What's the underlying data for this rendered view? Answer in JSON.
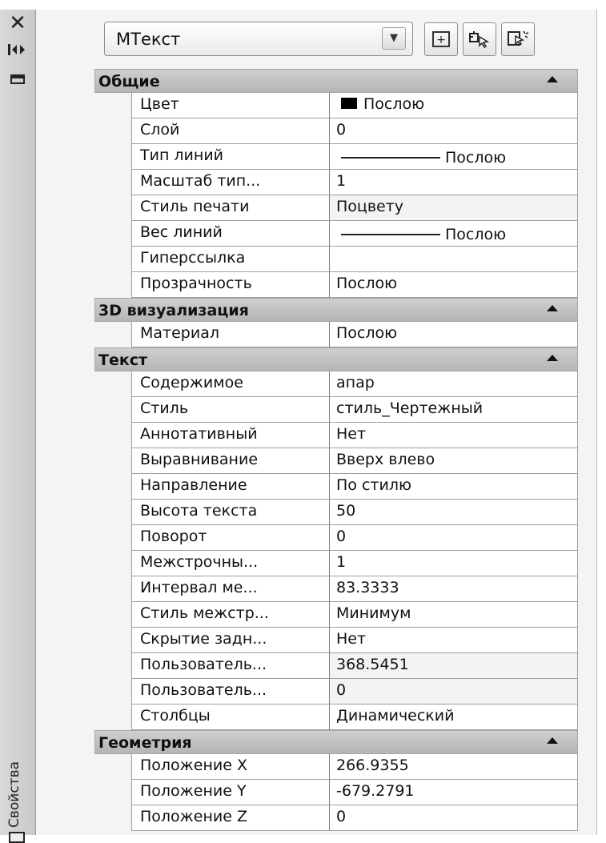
{
  "strip": {
    "close_icon": "✕",
    "autohide_icon": "⇹",
    "title": "Свойства"
  },
  "selector": {
    "value": "МТекст",
    "dropdown_icon": "chevron-down-icon"
  },
  "toolbar": {
    "buttons": [
      {
        "icon": "toggle-pickadd-icon"
      },
      {
        "icon": "select-objects-icon"
      },
      {
        "icon": "quick-select-icon"
      }
    ]
  },
  "sections": {
    "general": {
      "title": "Общие",
      "rows": [
        {
          "name": "Цвет",
          "value": "Послою"
        },
        {
          "name": "Слой",
          "value": "0"
        },
        {
          "name": "Тип линий",
          "value": "Послою"
        },
        {
          "name": "Масштаб тип...",
          "value": "1"
        },
        {
          "name": "Стиль печати",
          "value": "Поцвету"
        },
        {
          "name": "Вес линий",
          "value": "Послою"
        },
        {
          "name": "Гиперссылка",
          "value": ""
        },
        {
          "name": "Прозрачность",
          "value": "Послою"
        }
      ]
    },
    "viz3d": {
      "title": "3D визуализация",
      "rows": [
        {
          "name": "Материал",
          "value": "Послою"
        }
      ]
    },
    "text": {
      "title": "Текст",
      "rows": [
        {
          "name": "Содержимое",
          "value": "апар"
        },
        {
          "name": "Стиль",
          "value": "стиль_Чертежный"
        },
        {
          "name": "Аннотативный",
          "value": "Нет"
        },
        {
          "name": "Выравнивание",
          "value": "Вверх влево"
        },
        {
          "name": "Направление",
          "value": "По стилю"
        },
        {
          "name": "Высота текста",
          "value": "50"
        },
        {
          "name": "Поворот",
          "value": "0"
        },
        {
          "name": "Межстрочны...",
          "value": "1"
        },
        {
          "name": "Интервал ме...",
          "value": "83.3333"
        },
        {
          "name": "Стиль межстр...",
          "value": "Минимум"
        },
        {
          "name": "Скрытие задн...",
          "value": "Нет"
        },
        {
          "name": "Пользователь...",
          "value": "368.5451"
        },
        {
          "name": "Пользователь...",
          "value": "0"
        },
        {
          "name": "Столбцы",
          "value": "Динамический"
        }
      ]
    },
    "geometry": {
      "title": "Геометрия",
      "rows": [
        {
          "name": "Положение X",
          "value": "266.9355"
        },
        {
          "name": "Положение Y",
          "value": "-679.2791"
        },
        {
          "name": "Положение Z",
          "value": "0"
        }
      ]
    }
  }
}
